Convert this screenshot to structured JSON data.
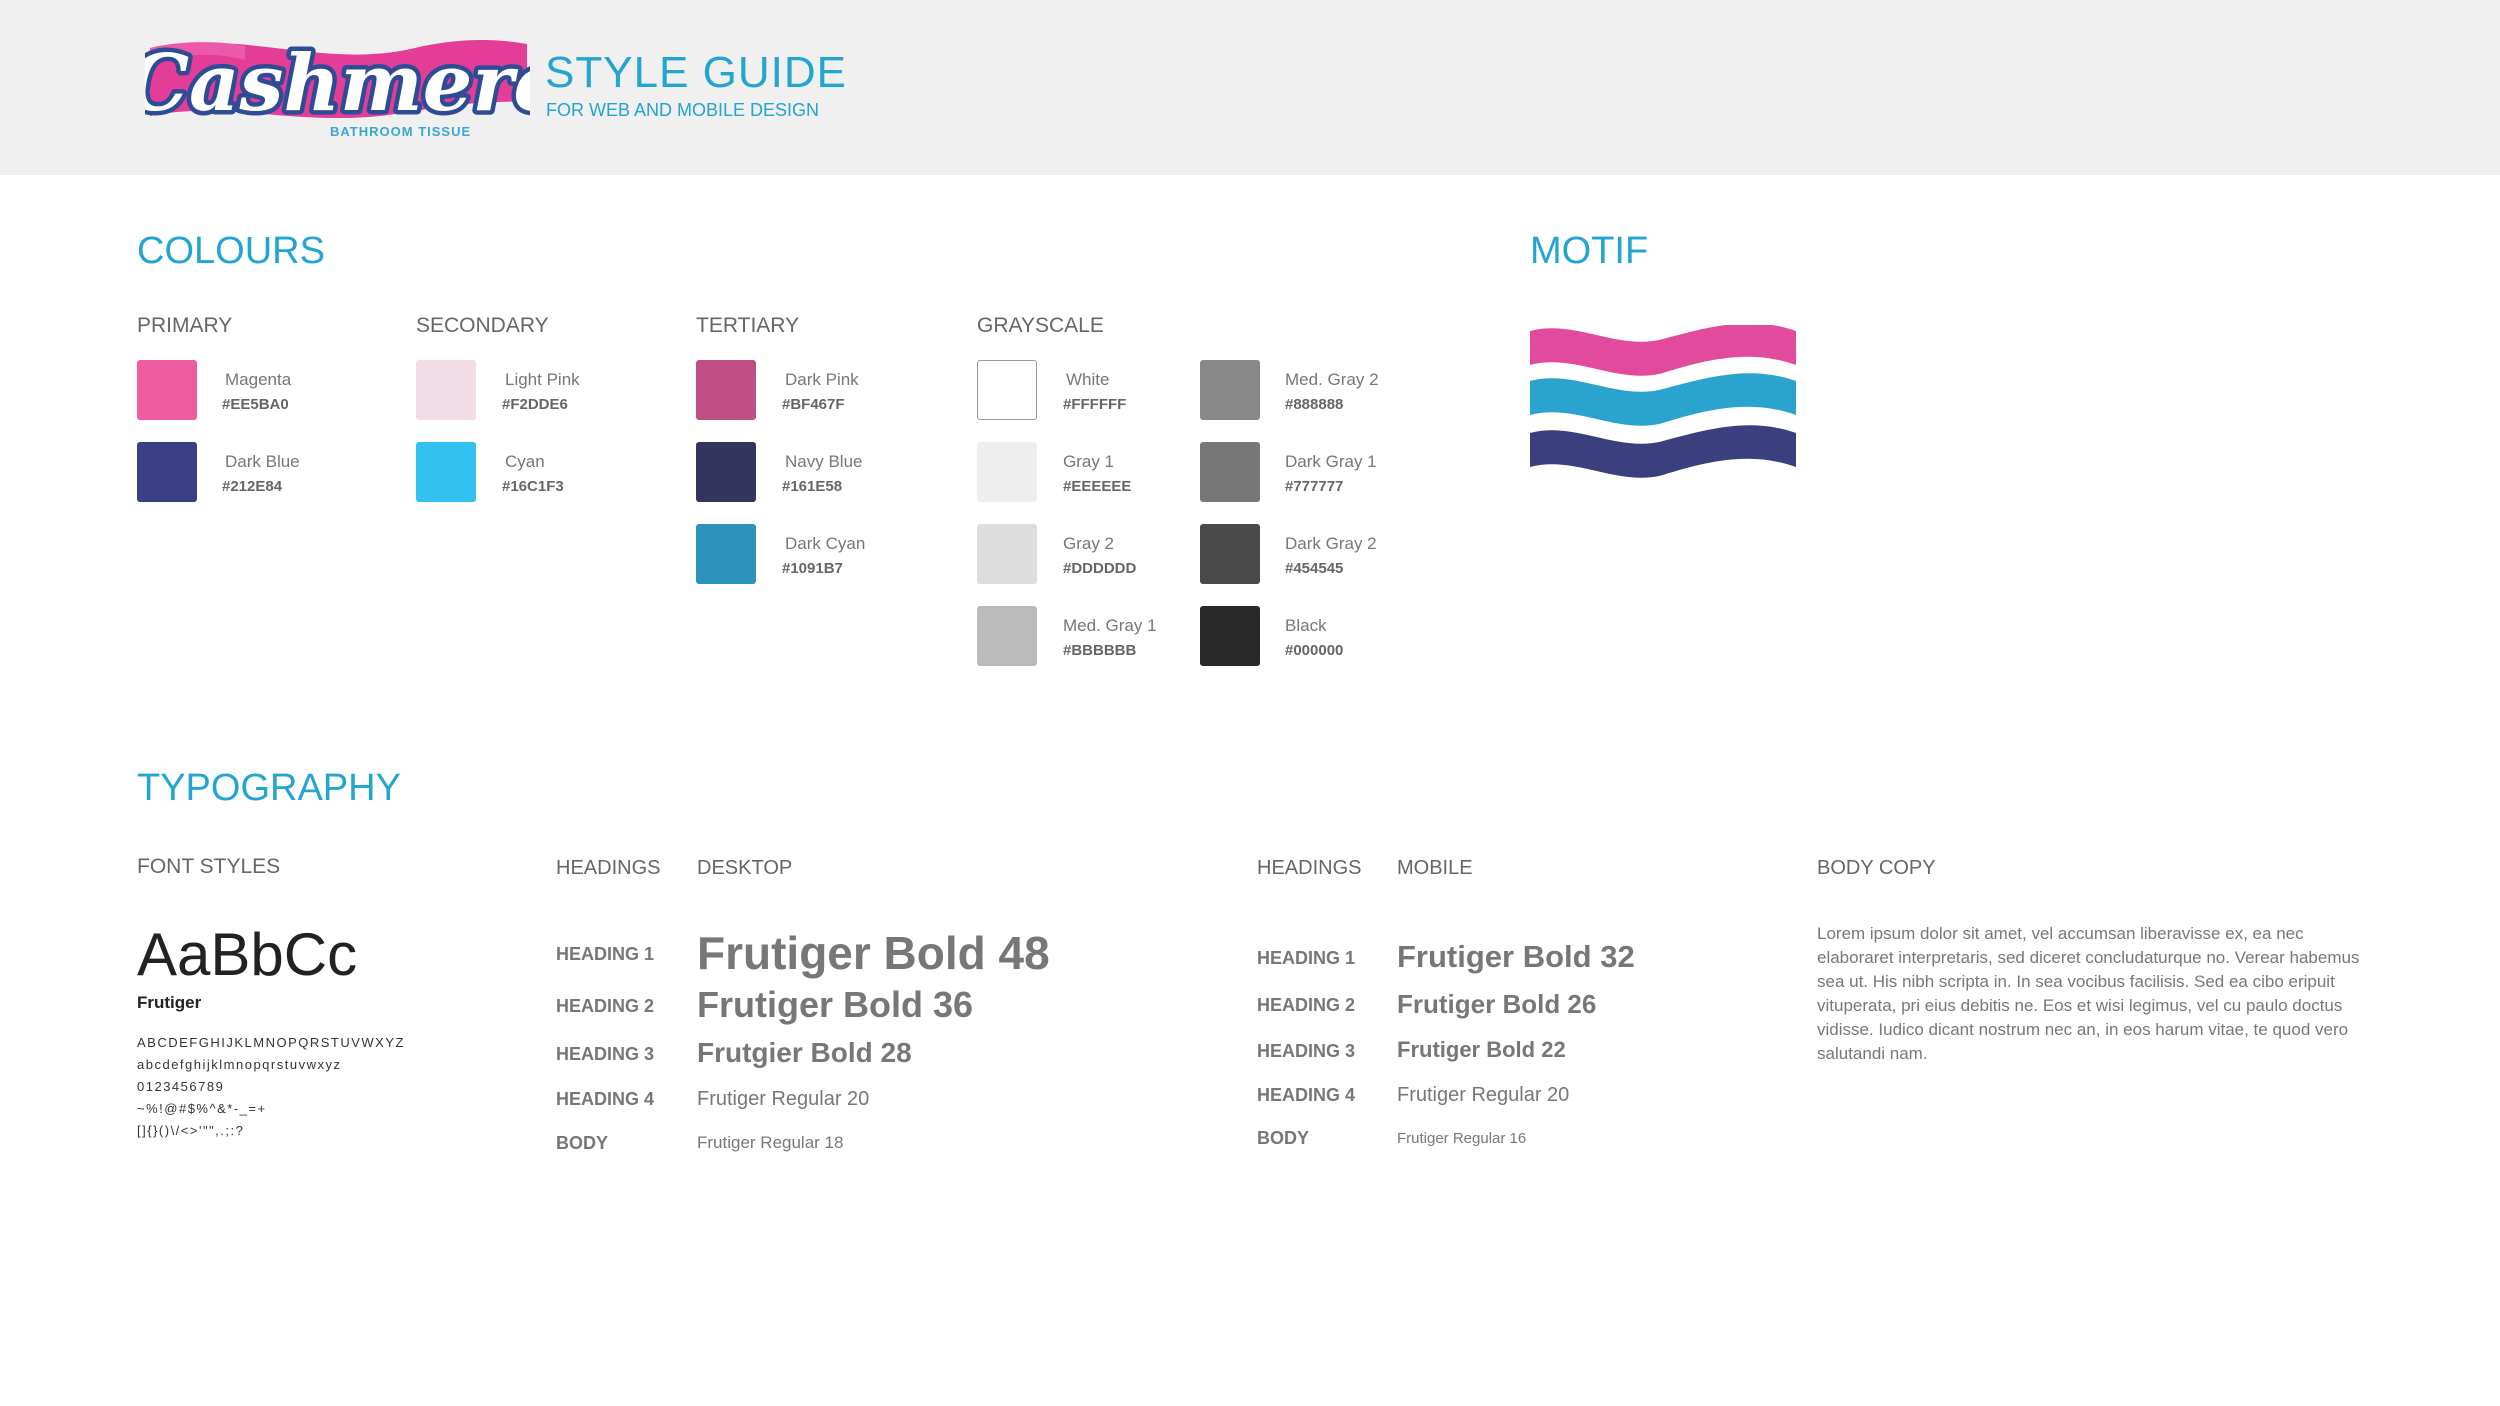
{
  "header": {
    "logo_text": "Cashmere",
    "logo_tagline": "BATHROOM TISSUE",
    "title": "STYLE GUIDE",
    "subtitle": "FOR WEB AND MOBILE DESIGN"
  },
  "colours": {
    "title": "COLOURS",
    "groups": {
      "primary": {
        "label": "PRIMARY",
        "items": [
          {
            "name": "Magenta",
            "hex": "#EE5BA0",
            "color": "#EE5BA0"
          },
          {
            "name": "Dark Blue",
            "hex": "#212E84",
            "color": "#3B3F84"
          }
        ]
      },
      "secondary": {
        "label": "SECONDARY",
        "items": [
          {
            "name": "Light Pink",
            "hex": "#F2DDE6",
            "color": "#F2DDE6"
          },
          {
            "name": "Cyan",
            "hex": "#16C1F3",
            "color": "#33C2EF"
          }
        ]
      },
      "tertiary": {
        "label": "TERTIARY",
        "items": [
          {
            "name": "Dark Pink",
            "hex": "#BF467F",
            "color": "#C04F84"
          },
          {
            "name": "Navy Blue",
            "hex": "#161E58",
            "color": "#33355C"
          },
          {
            "name": "Dark Cyan",
            "hex": "#1091B7",
            "color": "#2B93BC"
          }
        ]
      },
      "grayscale": {
        "label": "GRAYSCALE",
        "items": [
          {
            "name": "White",
            "hex": "#FFFFFF",
            "color": "#FFFFFF"
          },
          {
            "name": "Gray 1",
            "hex": "#EEEEEE",
            "color": "#EEEEEE"
          },
          {
            "name": "Gray 2",
            "hex": "#DDDDDD",
            "color": "#DDDDDD"
          },
          {
            "name": "Med. Gray 1",
            "hex": "#BBBBBB",
            "color": "#BBBBBB"
          },
          {
            "name": "Med. Gray 2",
            "hex": "#888888",
            "color": "#888888"
          },
          {
            "name": "Dark Gray 1",
            "hex": "#777777",
            "color": "#777777"
          },
          {
            "name": "Dark Gray 2",
            "hex": "#454545",
            "color": "#4A4A4A"
          },
          {
            "name": "Black",
            "hex": "#000000",
            "color": "#282828"
          }
        ]
      }
    }
  },
  "motif": {
    "title": "MOTIF",
    "colors": [
      "#E24A9E",
      "#2AA3CF",
      "#3B3F7E"
    ]
  },
  "typography": {
    "title": "TYPOGRAPHY",
    "font_styles": {
      "label": "FONT STYLES",
      "sample": "AaBbCc",
      "font_name": "Frutiger",
      "charset": [
        "ABCDEFGHIJKLMNOPQRSTUVWXYZ",
        "abcdefghijklmnopqrstuvwxyz",
        "0123456789",
        "~%!@#$%^&*-_=+",
        "[]{}()\\/<>'\"\",.;:?"
      ]
    },
    "desktop": {
      "headings_label": "HEADINGS",
      "label": "DESKTOP",
      "rows": [
        {
          "label": "HEADING 1",
          "sample": "Frutiger Bold 48"
        },
        {
          "label": "HEADING 2",
          "sample": "Frutiger Bold 36"
        },
        {
          "label": "HEADING 3",
          "sample": "Frutgier Bold 28"
        },
        {
          "label": "HEADING 4",
          "sample": "Frutiger Regular 20"
        },
        {
          "label": "BODY",
          "sample": "Frutiger Regular 18"
        }
      ]
    },
    "mobile": {
      "headings_label": "HEADINGS",
      "label": "MOBILE",
      "rows": [
        {
          "label": "HEADING 1",
          "sample": "Frutiger Bold 32"
        },
        {
          "label": "HEADING 2",
          "sample": "Frutiger Bold 26"
        },
        {
          "label": "HEADING 3",
          "sample": "Frutiger Bold 22"
        },
        {
          "label": "HEADING 4",
          "sample": "Frutiger Regular 20"
        },
        {
          "label": "BODY",
          "sample": "Frutiger Regular 16"
        }
      ]
    },
    "body_copy": {
      "label": "BODY COPY",
      "text": "Lorem ipsum dolor sit amet, vel accumsan liberavisse ex, ea nec elaboraret interpretaris, sed diceret concludaturque no. Verear habemus sea ut. His nibh scripta in. In sea vocibus facilisis. Sed ea cibo eripuit vituperata, pri eius debitis ne. Eos et wisi legimus, vel cu paulo doctus vidisse. Iudico dicant nostrum nec an, in eos harum vitae, te quod vero salutandi nam."
    }
  }
}
